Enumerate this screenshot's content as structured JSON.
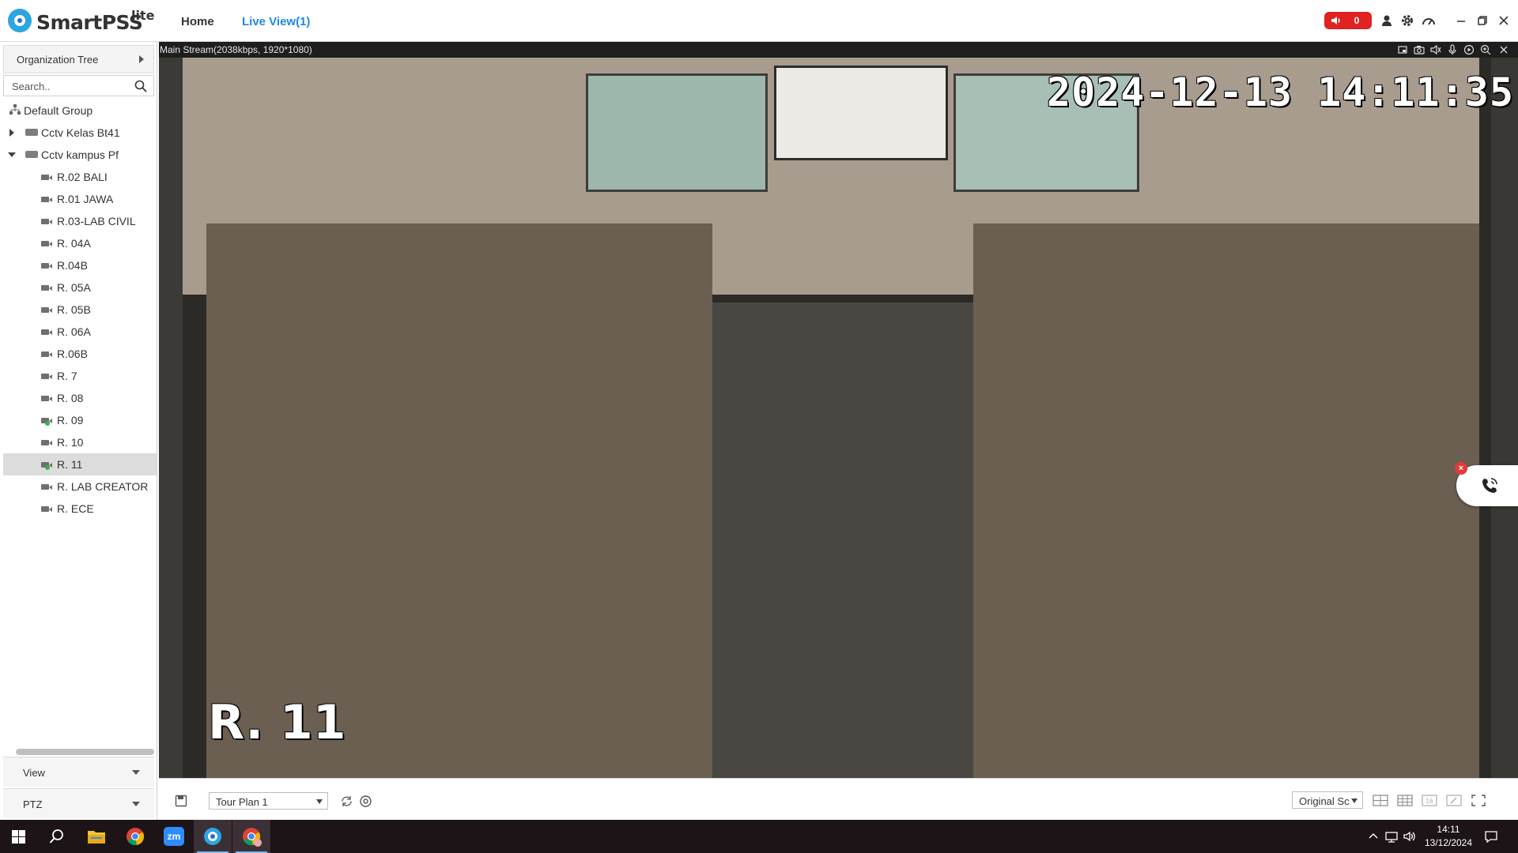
{
  "app": {
    "name": "SmartPSS",
    "edition": "lite",
    "nav": {
      "home": "Home",
      "live_view": "Live View(1)"
    },
    "alarm_count": "0",
    "accent_color": "#1e88e5",
    "alarm_color": "#e02222"
  },
  "sidebar": {
    "org_tree_label": "Organization Tree",
    "search_placeholder": "Search..",
    "tree": [
      {
        "label": "Default Group",
        "type": "group"
      },
      {
        "label": "Cctv Kelas Bt41",
        "type": "device",
        "expanded": false
      },
      {
        "label": "Cctv kampus Pf",
        "type": "device",
        "expanded": true
      },
      {
        "label": "R.02 BALI",
        "type": "camera",
        "online": false
      },
      {
        "label": "R.01 JAWA",
        "type": "camera",
        "online": false
      },
      {
        "label": "R.03-LAB CIVIL",
        "type": "camera",
        "online": false
      },
      {
        "label": "R. 04A",
        "type": "camera",
        "online": false
      },
      {
        "label": "R.04B",
        "type": "camera",
        "online": false
      },
      {
        "label": "R. 05A",
        "type": "camera",
        "online": false
      },
      {
        "label": "R. 05B",
        "type": "camera",
        "online": false
      },
      {
        "label": "R. 06A",
        "type": "camera",
        "online": false
      },
      {
        "label": "R.06B",
        "type": "camera",
        "online": false
      },
      {
        "label": "R. 7",
        "type": "camera",
        "online": false
      },
      {
        "label": "R. 08",
        "type": "camera",
        "online": false
      },
      {
        "label": "R. 09",
        "type": "camera",
        "online": true
      },
      {
        "label": "R. 10",
        "type": "camera",
        "online": false
      },
      {
        "label": "R. 11",
        "type": "camera",
        "online": true,
        "selected": true
      },
      {
        "label": "R. LAB CREATOR",
        "type": "camera",
        "online": false
      },
      {
        "label": "R. ECE",
        "type": "camera",
        "online": false
      }
    ],
    "view_label": "View",
    "ptz_label": "PTZ"
  },
  "video": {
    "stream_info": "Main Stream(2038kbps, 1920*1080)",
    "osd_timestamp": "2024-12-13 14:11:35",
    "osd_channel": "R. 11",
    "header_icons": [
      "window-icon",
      "snapshot-icon",
      "audio-icon",
      "talk-icon",
      "record-icon",
      "zoom-icon",
      "close-icon"
    ]
  },
  "bottombar": {
    "tour_plan": "Tour Plan 1",
    "scale_mode": "Original Sc"
  },
  "taskbar": {
    "time": "14:11",
    "date": "13/12/2024",
    "apps": [
      "windows-start-icon",
      "search-icon",
      "file-explorer-icon",
      "chrome-icon",
      "zoom-app-icon",
      "smartpss-icon",
      "chrome-profile-icon"
    ],
    "zoom_label": "zm"
  }
}
